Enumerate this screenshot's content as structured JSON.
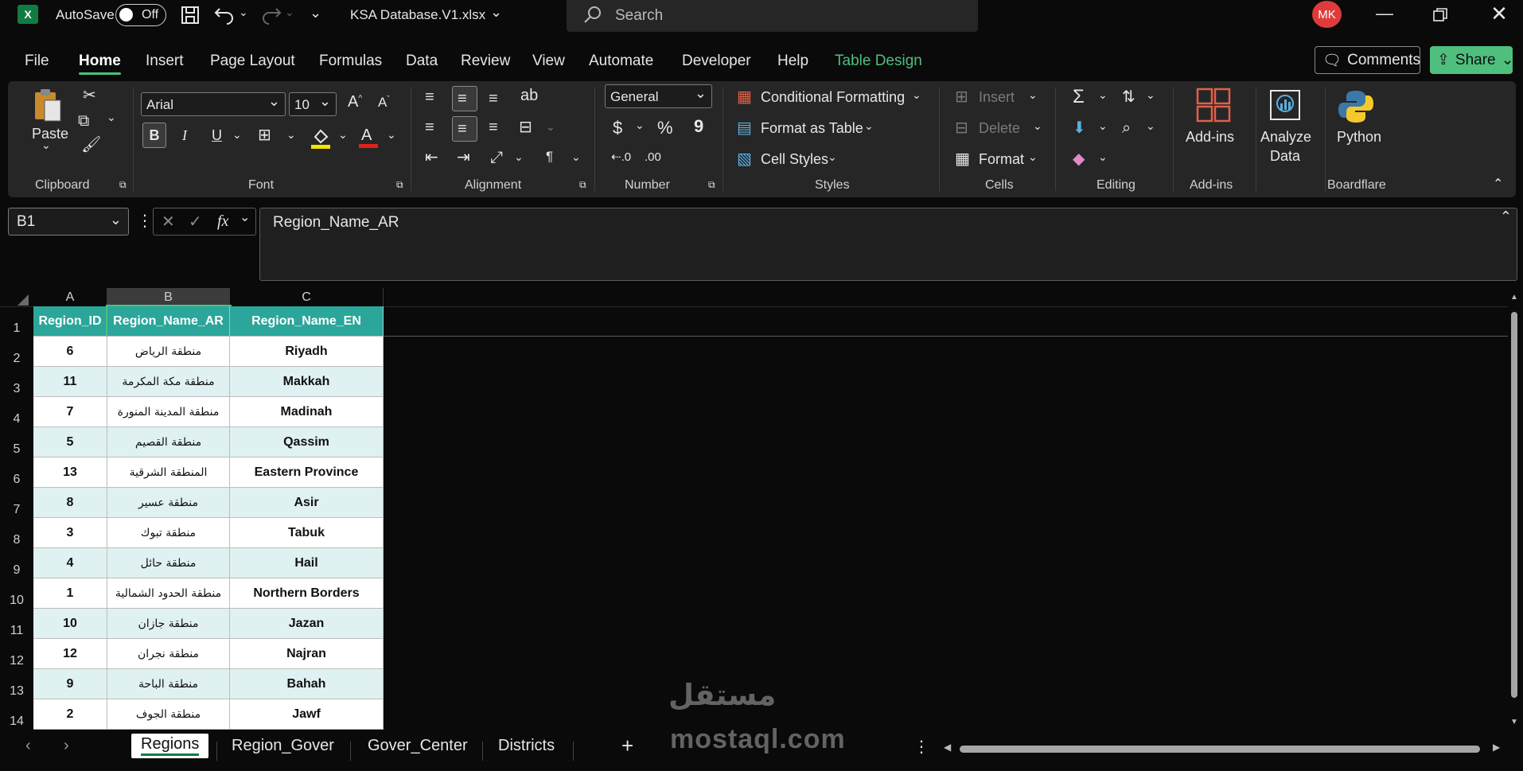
{
  "titlebar": {
    "app_letter": "X",
    "autosave_label": "AutoSave",
    "autosave_state": "Off",
    "filename": "KSA Database.V1.xlsx",
    "search_placeholder": "Search",
    "avatar_initials": "MK"
  },
  "menu": {
    "items": [
      "File",
      "Home",
      "Insert",
      "Page Layout",
      "Formulas",
      "Data",
      "Review",
      "View",
      "Automate",
      "Developer",
      "Help",
      "Table Design"
    ],
    "active": "Home",
    "comments_label": "Comments",
    "share_label": "Share"
  },
  "ribbon": {
    "clipboard": {
      "paste": "Paste",
      "label": "Clipboard"
    },
    "font": {
      "name": "Arial",
      "size": "10",
      "bold": "B",
      "italic": "I",
      "underline": "U",
      "label": "Font"
    },
    "alignment": {
      "label": "Alignment"
    },
    "number": {
      "format": "General",
      "currency": "$",
      "percent": "%",
      "comma": "9",
      "label": "Number"
    },
    "styles": {
      "conditional": "Conditional Formatting",
      "format_table": "Format as Table",
      "cell_styles": "Cell Styles",
      "label": "Styles"
    },
    "cells": {
      "insert": "Insert",
      "delete": "Delete",
      "format": "Format",
      "label": "Cells"
    },
    "editing": {
      "label": "Editing"
    },
    "addins": {
      "btn": "Add-ins",
      "label": "Add-ins"
    },
    "analyze": {
      "line1": "Analyze",
      "line2": "Data"
    },
    "python": {
      "btn": "Python",
      "label": "Boardflare"
    }
  },
  "formula_bar": {
    "cell_ref": "B1",
    "fx": "fx",
    "content": "Region_Name_AR"
  },
  "sheet": {
    "columns": [
      "A",
      "B",
      "C"
    ],
    "selected_column": "B",
    "rows": [
      [
        "Region_ID",
        "Region_Name_AR",
        "Region_Name_EN"
      ],
      [
        "6",
        "منطقة الرياض",
        "Riyadh"
      ],
      [
        "11",
        "منطقة مكة المكرمة",
        "Makkah"
      ],
      [
        "7",
        "منطقة المدينة المنورة",
        "Madinah"
      ],
      [
        "5",
        "منطقة القصيم",
        "Qassim"
      ],
      [
        "13",
        "المنطقة الشرقية",
        "Eastern Province"
      ],
      [
        "8",
        "منطقة عسير",
        "Asir"
      ],
      [
        "3",
        "منطقة تبوك",
        "Tabuk"
      ],
      [
        "4",
        "منطقة حائل",
        "Hail"
      ],
      [
        "1",
        "منطقة الحدود الشمالية",
        "Northern Borders"
      ],
      [
        "10",
        "منطقة جازان",
        "Jazan"
      ],
      [
        "12",
        "منطقة نجران",
        "Najran"
      ],
      [
        "9",
        "منطقة الباحة",
        "Bahah"
      ],
      [
        "2",
        "منطقة الجوف",
        "Jawf"
      ]
    ],
    "row_numbers": [
      "1",
      "2",
      "3",
      "4",
      "5",
      "6",
      "7",
      "8",
      "9",
      "10",
      "11",
      "12",
      "13",
      "14"
    ]
  },
  "tabs": {
    "items": [
      "Regions",
      "Region_Gover",
      "Gover_Center",
      "Districts"
    ],
    "active": "Regions"
  },
  "watermark": {
    "arabic": "مستقل",
    "latin": "mostaql.com"
  },
  "colors": {
    "accent": "#4fbf7d",
    "table_header": "#2ba69a",
    "band": "#dff1f0",
    "excel_green": "#107c41"
  }
}
